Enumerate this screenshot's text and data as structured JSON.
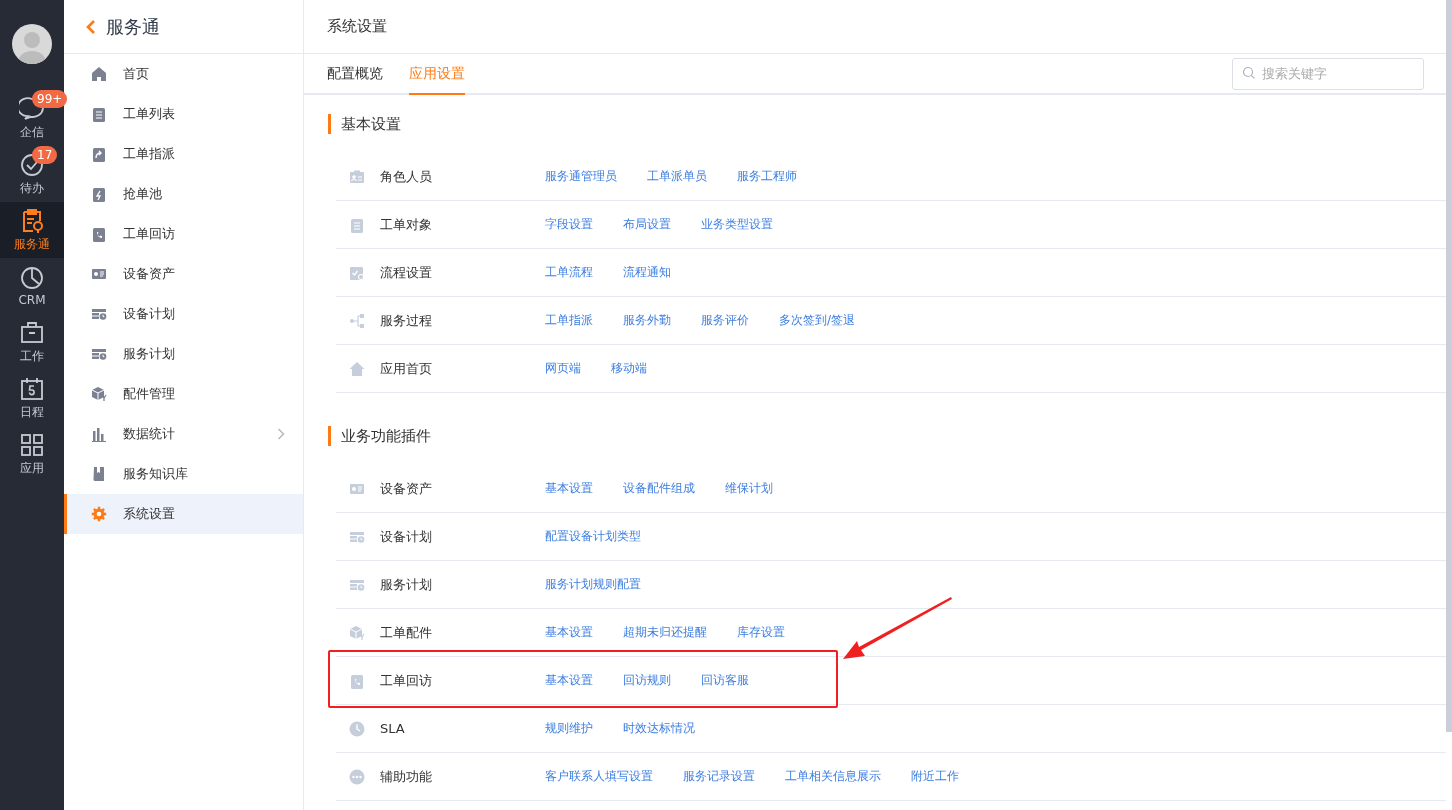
{
  "rail": {
    "items": [
      {
        "label": "企信",
        "badge": "99+",
        "selected": false
      },
      {
        "label": "待办",
        "badge": "17",
        "selected": false
      },
      {
        "label": "服务通",
        "selected": true
      },
      {
        "label": "CRM",
        "selected": false
      },
      {
        "label": "工作",
        "selected": false
      },
      {
        "label": "日程",
        "selected": false
      },
      {
        "label": "应用",
        "selected": false
      }
    ]
  },
  "sidebar": {
    "title": "服务通",
    "items": [
      {
        "label": "首页",
        "selected": false
      },
      {
        "label": "工单列表",
        "selected": false
      },
      {
        "label": "工单指派",
        "selected": false
      },
      {
        "label": "抢单池",
        "selected": false
      },
      {
        "label": "工单回访",
        "selected": false
      },
      {
        "label": "设备资产",
        "selected": false
      },
      {
        "label": "设备计划",
        "selected": false
      },
      {
        "label": "服务计划",
        "selected": false
      },
      {
        "label": "配件管理",
        "selected": false
      },
      {
        "label": "数据统计",
        "selected": false,
        "expandable": true
      },
      {
        "label": "服务知识库",
        "selected": false
      },
      {
        "label": "系统设置",
        "selected": true
      }
    ]
  },
  "page": {
    "title": "系统设置"
  },
  "tabs": [
    {
      "label": "配置概览",
      "selected": false
    },
    {
      "label": "应用设置",
      "selected": true
    }
  ],
  "search": {
    "placeholder": "搜索关键字"
  },
  "sections": [
    {
      "title": "基本设置",
      "rows": [
        {
          "name": "角色人员",
          "links": [
            "服务通管理员",
            "工单派单员",
            "服务工程师"
          ],
          "highlighted": false
        },
        {
          "name": "工单对象",
          "links": [
            "字段设置",
            "布局设置",
            "业务类型设置"
          ],
          "highlighted": false
        },
        {
          "name": "流程设置",
          "links": [
            "工单流程",
            "流程通知"
          ],
          "highlighted": false
        },
        {
          "name": "服务过程",
          "links": [
            "工单指派",
            "服务外勤",
            "服务评价",
            "多次签到/签退"
          ],
          "highlighted": false
        },
        {
          "name": "应用首页",
          "links": [
            "网页端",
            "移动端"
          ],
          "highlighted": false
        }
      ]
    },
    {
      "title": "业务功能插件",
      "rows": [
        {
          "name": "设备资产",
          "links": [
            "基本设置",
            "设备配件组成",
            "维保计划"
          ],
          "highlighted": false
        },
        {
          "name": "设备计划",
          "links": [
            "配置设备计划类型"
          ],
          "highlighted": false
        },
        {
          "name": "服务计划",
          "links": [
            "服务计划规则配置"
          ],
          "highlighted": false
        },
        {
          "name": "工单配件",
          "links": [
            "基本设置",
            "超期未归还提醒",
            "库存设置"
          ],
          "highlighted": false
        },
        {
          "name": "工单回访",
          "links": [
            "基本设置",
            "回访规则",
            "回访客服"
          ],
          "highlighted": true
        },
        {
          "name": "SLA",
          "links": [
            "规则维护",
            "时效达标情况"
          ],
          "highlighted": false
        },
        {
          "name": "辅助功能",
          "links": [
            "客户联系人填写设置",
            "服务记录设置",
            "工单相关信息展示",
            "附近工作"
          ],
          "highlighted": false
        }
      ]
    }
  ]
}
